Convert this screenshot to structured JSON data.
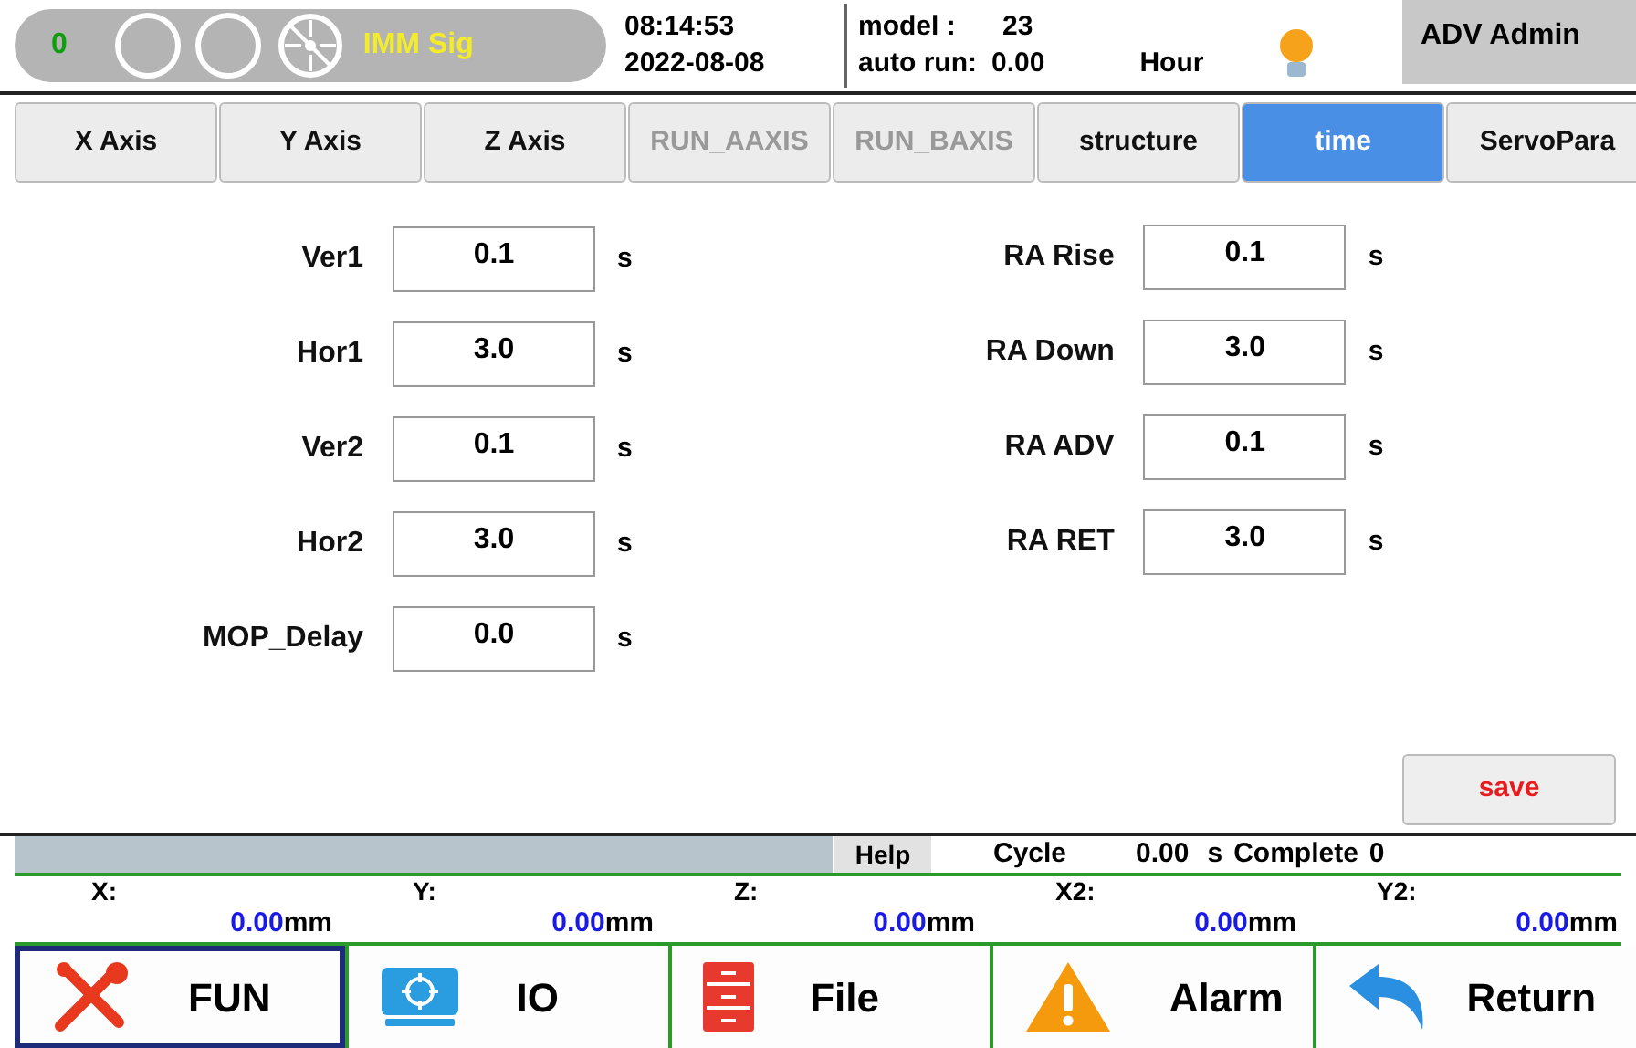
{
  "header": {
    "counter": "0",
    "signal": "IMM Sig",
    "time": "08:14:53",
    "date": "2022-08-08",
    "model_label": "model :",
    "model": "23",
    "auto_run_label": "auto run:",
    "auto_run": "0.00",
    "hour": "Hour",
    "user": "ADV Admin"
  },
  "tabs": [
    {
      "label": "X Axis",
      "selected": false,
      "disabled": false
    },
    {
      "label": "Y Axis",
      "selected": false,
      "disabled": false
    },
    {
      "label": "Z Axis",
      "selected": false,
      "disabled": false
    },
    {
      "label": "RUN_AAXIS",
      "selected": false,
      "disabled": true
    },
    {
      "label": "RUN_BAXIS",
      "selected": false,
      "disabled": true
    },
    {
      "label": "structure",
      "selected": false,
      "disabled": false
    },
    {
      "label": "time",
      "selected": true,
      "disabled": false
    },
    {
      "label": "ServoPara",
      "selected": false,
      "disabled": false
    }
  ],
  "left_fields": [
    {
      "label": "Ver1",
      "value": "0.1",
      "unit": "s"
    },
    {
      "label": "Hor1",
      "value": "3.0",
      "unit": "s"
    },
    {
      "label": "Ver2",
      "value": "0.1",
      "unit": "s"
    },
    {
      "label": "Hor2",
      "value": "3.0",
      "unit": "s"
    },
    {
      "label": "MOP_Delay",
      "value": "0.0",
      "unit": "s"
    }
  ],
  "right_fields": [
    {
      "label": "RA Rise",
      "value": "0.1",
      "unit": "s"
    },
    {
      "label": "RA Down",
      "value": "3.0",
      "unit": "s"
    },
    {
      "label": "RA ADV",
      "value": "0.1",
      "unit": "s"
    },
    {
      "label": "RA RET",
      "value": "3.0",
      "unit": "s"
    }
  ],
  "save": "save",
  "status": {
    "help": "Help",
    "cycle_label": "Cycle",
    "cycle": "0.00",
    "cycle_unit": "s",
    "complete_label": "Complete",
    "complete": "0"
  },
  "coords": [
    {
      "label": "X:",
      "value": "0.00",
      "unit": "mm"
    },
    {
      "label": "Y:",
      "value": "0.00",
      "unit": "mm"
    },
    {
      "label": "Z:",
      "value": "0.00",
      "unit": "mm"
    },
    {
      "label": "X2:",
      "value": "0.00",
      "unit": "mm"
    },
    {
      "label": "Y2:",
      "value": "0.00",
      "unit": "mm"
    }
  ],
  "nav": [
    {
      "label": "FUN",
      "kind": "tools",
      "selected": true
    },
    {
      "label": "IO",
      "kind": "io",
      "selected": false
    },
    {
      "label": "File",
      "kind": "file",
      "selected": false
    },
    {
      "label": "Alarm",
      "kind": "alarm",
      "selected": false
    },
    {
      "label": "Return",
      "kind": "return",
      "selected": false
    }
  ]
}
